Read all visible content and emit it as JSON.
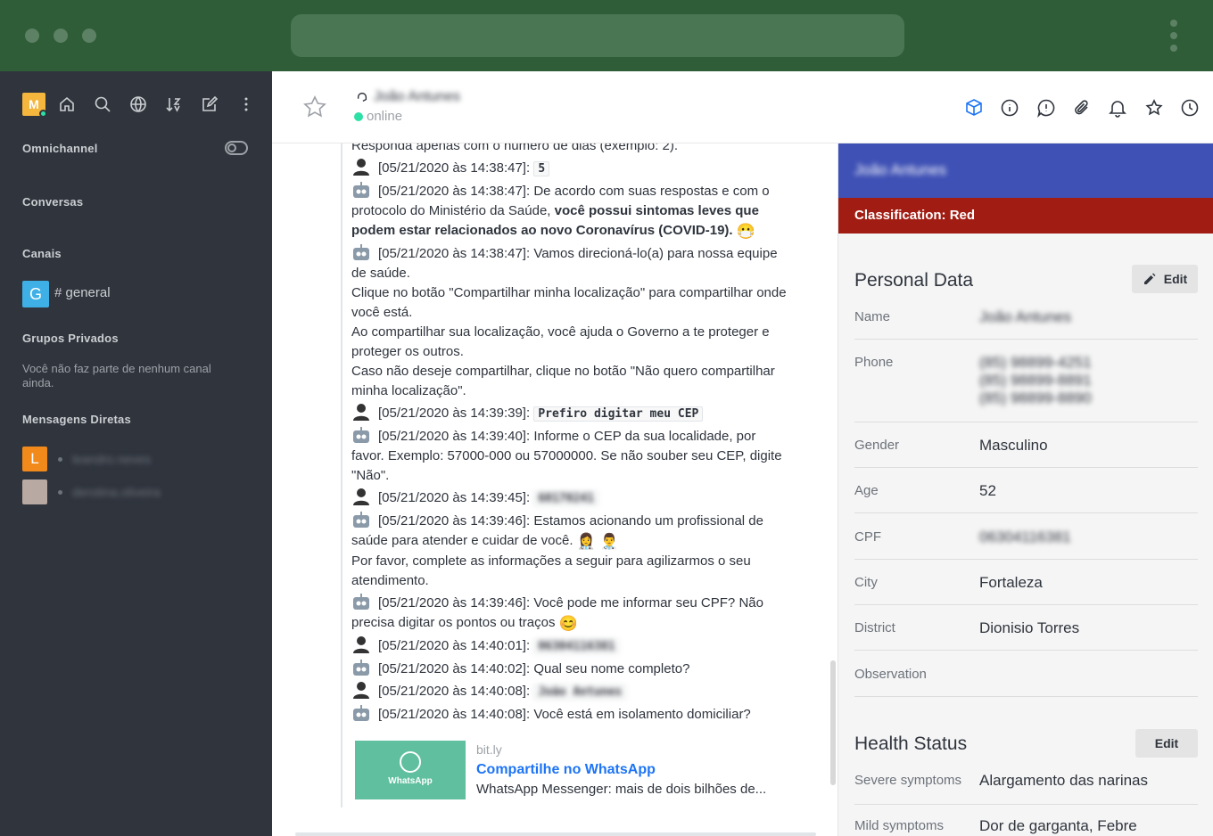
{
  "sidebar": {
    "avatar_letter": "M",
    "sections": {
      "omnichannel": "Omnichannel",
      "conversas": "Conversas",
      "canais": "Canais",
      "grupos": "Grupos Privados",
      "diretas": "Mensagens Diretas"
    },
    "channel": {
      "letter": "G",
      "name": "# general"
    },
    "grupos_empty": "Você não faz parte de nenhum canal ainda.",
    "dms": [
      {
        "letter": "L",
        "name": "leandro.neves"
      },
      {
        "letter": "",
        "name": "derotina.oliveira"
      }
    ]
  },
  "header": {
    "title": "João Antunes",
    "status": "online"
  },
  "messages": {
    "top_partial": "Responda apenas com o número de dias (exemplo: 2).",
    "lines": [
      {
        "ts": "[05/21/2020 às 14:38:47]:",
        "code": "5"
      },
      {
        "ts": "[05/21/2020 às 14:38:47]:",
        "text_a": "De acordo com suas respostas e com o protocolo do Ministério da Saúde,",
        "text_b": "você possui sintomas leves que podem estar relacionados ao novo Coronavírus (COVID-19).",
        "emoji": "😷"
      },
      {
        "ts": "[05/21/2020 às 14:38:47]:",
        "text": "Vamos direcioná-lo(a) para nossa equipe de saúde."
      },
      {
        "text": "Clique no botão \"Compartilhar minha localização\" para compartilhar onde você está."
      },
      {
        "text": "Ao compartilhar sua localização, você ajuda o Governo a te proteger e proteger os outros."
      },
      {
        "text": "Caso não deseje compartilhar, clique no botão \"Não quero compartilhar minha localização\"."
      },
      {
        "ts": "[05/21/2020 às 14:39:39]:",
        "code": "Prefiro digitar meu CEP"
      },
      {
        "ts": "[05/21/2020 às 14:39:40]:",
        "text": "Informe o CEP da sua localidade, por favor. Exemplo: 57000-000 ou 57000000. Se não souber seu CEP, digite \"Não\"."
      },
      {
        "ts": "[05/21/2020 às 14:39:45]:",
        "code": "60170241"
      },
      {
        "ts": "[05/21/2020 às 14:39:46]:",
        "text": "Estamos acionando um profissional de saúde para atender e cuidar de você.",
        "emoji": "👩‍⚕️ 👨‍⚕️"
      },
      {
        "text": "Por favor, complete as informações a seguir para agilizarmos o seu atendimento."
      },
      {
        "ts": "[05/21/2020 às 14:39:46]:",
        "text": "Você pode me informar seu CPF? Não precisa digitar os pontos ou traços",
        "emoji": "😊"
      },
      {
        "ts": "[05/21/2020 às 14:40:01]:",
        "code": "06304116381"
      },
      {
        "ts": "[05/21/2020 às 14:40:02]:",
        "text": "Qual seu nome completo?"
      },
      {
        "ts": "[05/21/2020 às 14:40:08]:",
        "code": "João Antunes"
      },
      {
        "ts": "[05/21/2020 às 14:40:08]:",
        "text": "Você está em isolamento domiciliar?"
      }
    ],
    "card": {
      "img_label": "WhatsApp",
      "host": "bit.ly",
      "title": "Compartilhe no WhatsApp",
      "desc": "WhatsApp Messenger: mais de dois bilhões de..."
    }
  },
  "panel": {
    "name": "João Antunes",
    "classification": "Classification: Red",
    "personal_title": "Personal Data",
    "edit_label": "Edit",
    "fields": {
      "name": {
        "label": "Name",
        "value": "João Antunes"
      },
      "phone": {
        "label": "Phone",
        "value1": "(85) 98899-4251",
        "value2": "(85) 98899-8891",
        "value3": "(85) 98899-8890"
      },
      "gender": {
        "label": "Gender",
        "value": "Masculino"
      },
      "age": {
        "label": "Age",
        "value": "52"
      },
      "cpf": {
        "label": "CPF",
        "value": "06304116381"
      },
      "city": {
        "label": "City",
        "value": "Fortaleza"
      },
      "district": {
        "label": "District",
        "value": "Dionisio Torres"
      },
      "observation": {
        "label": "Observation",
        "value": ""
      }
    },
    "health_title": "Health Status",
    "health_fields": {
      "severe": {
        "label": "Severe symptoms",
        "value": "Alargamento das narinas"
      },
      "mild": {
        "label": "Mild symptoms",
        "value": "Dor de garganta, Febre"
      }
    }
  },
  "colors": {
    "chrome": "#2e5d37",
    "sidebar": "#2f343d",
    "panel_header": "#3f51b5",
    "classification": "#a11d14",
    "link": "#1d74f5"
  }
}
